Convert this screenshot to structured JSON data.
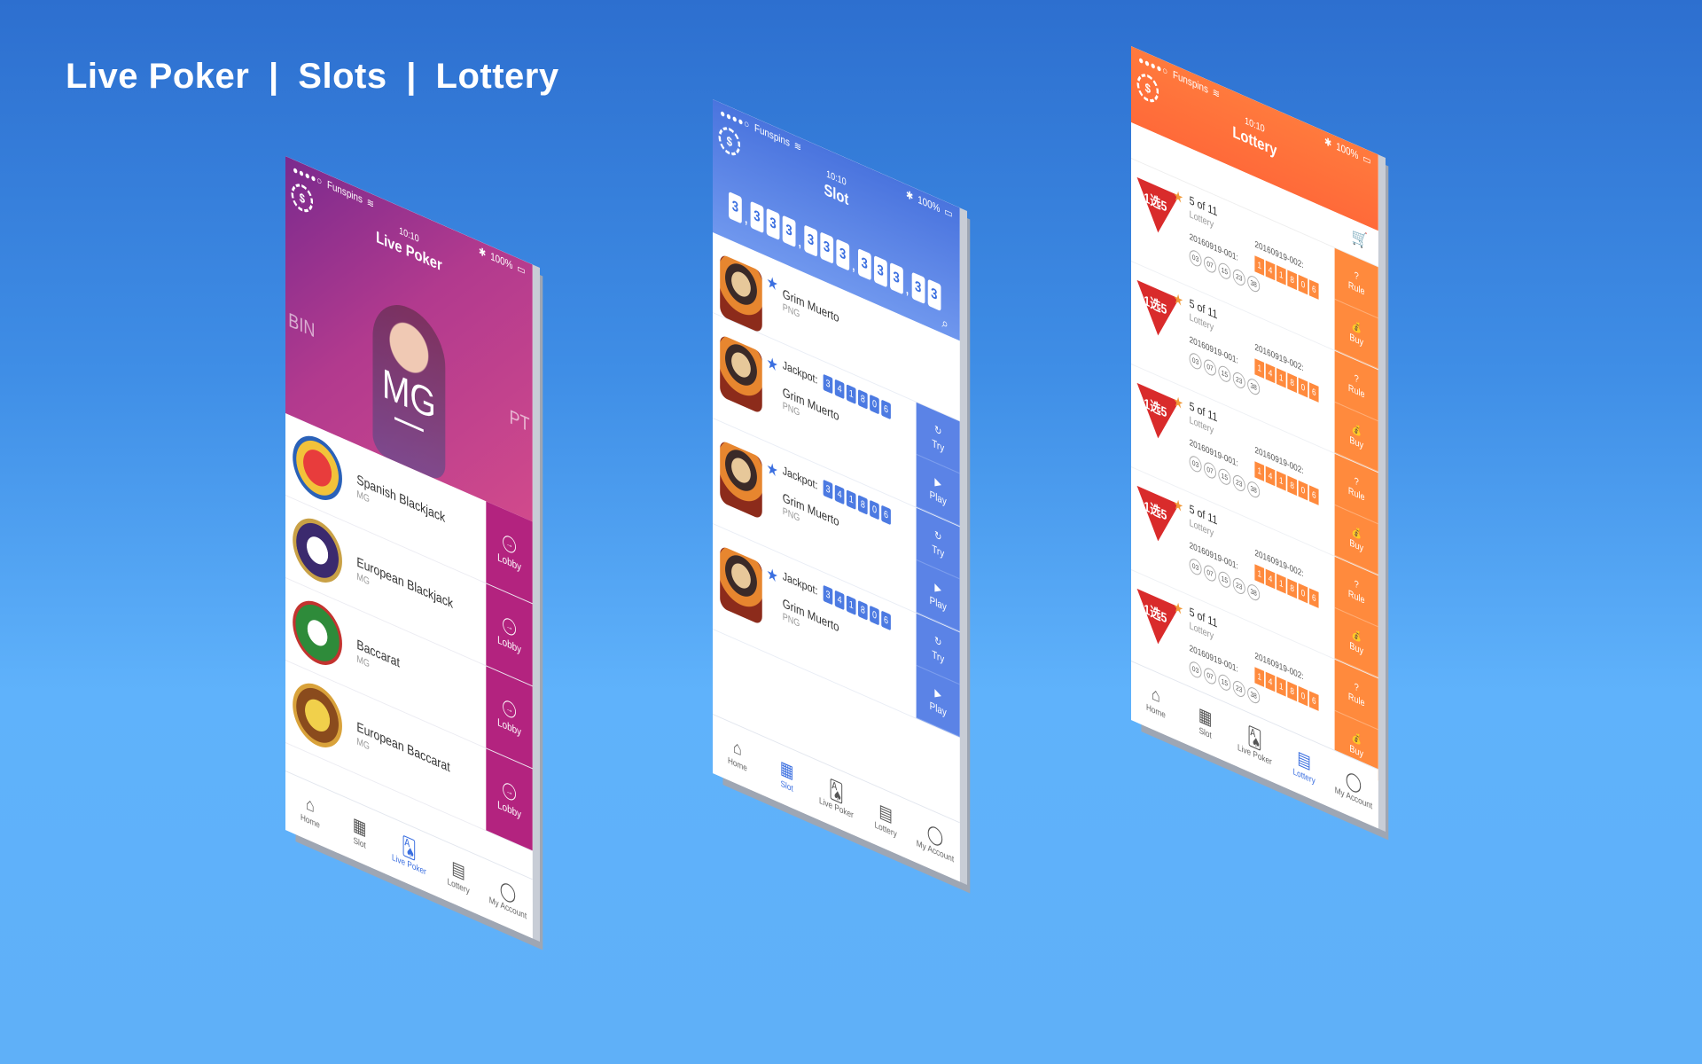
{
  "headline": {
    "part1": "Live Poker",
    "sep1": "|",
    "part2": "Slots",
    "sep2": "|",
    "part3": "Lottery"
  },
  "status": {
    "carrier": "Funspins",
    "time": "10:10",
    "battery": "100%"
  },
  "tabs": [
    "Home",
    "Slot",
    "Live Poker",
    "Lottery",
    "My Account"
  ],
  "colors": {
    "poker": "#b3237f",
    "slot": "#4a74de",
    "lottery": "#ff7a3d"
  },
  "poker": {
    "title": "Live Poker",
    "provider": "MG",
    "side_left": "BIN",
    "side_right": "PT",
    "button": "Lobby",
    "games": [
      {
        "name": "Spanish Blackjack",
        "sub": "MG"
      },
      {
        "name": "European Blackjack",
        "sub": "MG"
      },
      {
        "name": "Baccarat",
        "sub": "MG"
      },
      {
        "name": "European Baccarat",
        "sub": "MG"
      }
    ]
  },
  "slot": {
    "title": "Slot",
    "counter": [
      "3",
      ",",
      "3",
      "3",
      "3",
      ",",
      "3",
      "3",
      "3",
      ",",
      "3",
      "3",
      "3",
      ",",
      "3",
      "3"
    ],
    "jackpot_label": "Jackpot:",
    "jackpot": [
      "3",
      "4",
      "1",
      "8",
      "0",
      "6"
    ],
    "try": "Try",
    "play": "Play",
    "games": [
      {
        "name": "Grim Muerto",
        "sub": "PNG",
        "jackpot": false
      },
      {
        "name": "Grim Muerto",
        "sub": "PNG",
        "jackpot": true
      },
      {
        "name": "Grim Muerto",
        "sub": "PNG",
        "jackpot": true
      },
      {
        "name": "Grim Muerto",
        "sub": "PNG",
        "jackpot": true
      },
      {
        "name": "Grim Muerto",
        "sub": "PNG",
        "jackpot": true
      }
    ]
  },
  "lottery": {
    "title": "Lottery",
    "logo_text": "11选5",
    "name": "5 of 11",
    "sub": "Lottery",
    "period_prev": "20160919-001:",
    "period_cur": "20160919-002:",
    "balls": [
      "03",
      "07",
      "15",
      "23",
      "38"
    ],
    "open": [
      "1",
      "4",
      "1",
      "8",
      "0",
      "6"
    ],
    "rule": "Rule",
    "buy": "Buy",
    "rows": 5
  }
}
